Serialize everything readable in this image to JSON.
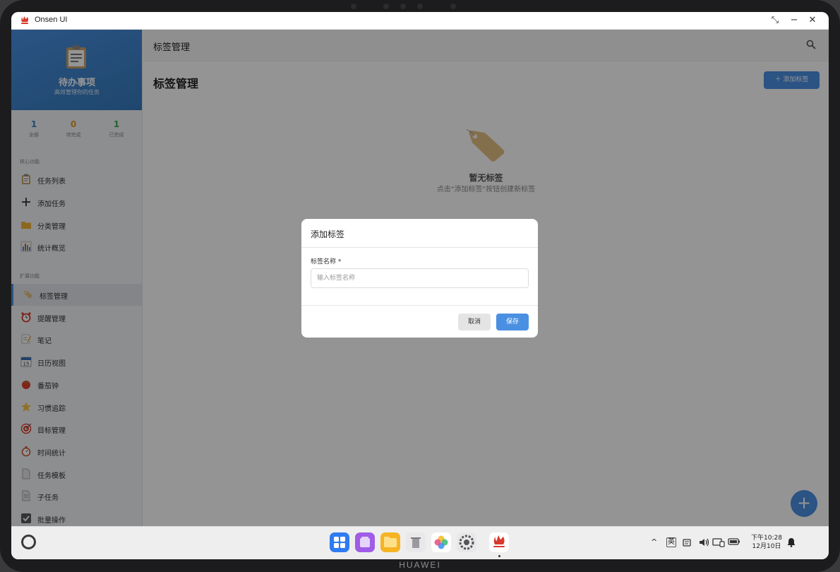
{
  "window": {
    "title": "Onsen UI",
    "brand": "HUAWEI"
  },
  "sidebar": {
    "app_name": "待办事项",
    "app_subtitle": "高效管理你的任务",
    "stats": [
      {
        "value": "1",
        "label": "全部",
        "color": "#3b82c4"
      },
      {
        "value": "0",
        "label": "待完成",
        "color": "#e09a2b"
      },
      {
        "value": "1",
        "label": "已完成",
        "color": "#3aa856"
      }
    ],
    "section_core": "核心功能",
    "section_ext": "扩展功能",
    "core_items": [
      {
        "label": "任务列表",
        "icon": "clipboard-icon"
      },
      {
        "label": "添加任务",
        "icon": "plus-icon"
      },
      {
        "label": "分类管理",
        "icon": "folder-icon"
      },
      {
        "label": "统计概览",
        "icon": "bar-chart-icon"
      }
    ],
    "ext_items": [
      {
        "label": "标签管理",
        "icon": "tag-icon",
        "active": true
      },
      {
        "label": "提醒管理",
        "icon": "alarm-clock-icon"
      },
      {
        "label": "笔记",
        "icon": "memo-icon"
      },
      {
        "label": "日历视图",
        "icon": "calendar-icon"
      },
      {
        "label": "番茄钟",
        "icon": "tomato-icon"
      },
      {
        "label": "习惯追踪",
        "icon": "star-icon"
      },
      {
        "label": "目标管理",
        "icon": "target-icon"
      },
      {
        "label": "时间统计",
        "icon": "stopwatch-icon"
      },
      {
        "label": "任务模板",
        "icon": "document-icon"
      },
      {
        "label": "子任务",
        "icon": "subtask-icon"
      },
      {
        "label": "批量操作",
        "icon": "checkbox-icon"
      }
    ]
  },
  "main": {
    "topbar_title": "标签管理",
    "page_title": "标签管理",
    "add_tag_button": "＋ 添加标签",
    "empty_title": "暂无标签",
    "empty_subtitle": "点击\"添加标签\"按钮创建新标签",
    "fab": "+"
  },
  "dialog": {
    "title": "添加标签",
    "field_label": "标签名称 *",
    "field_placeholder": "输入标签名称",
    "field_value": "",
    "cancel": "取消",
    "save": "保存"
  },
  "taskbar": {
    "ime": "英",
    "time": "下午10:28",
    "date": "12月10日",
    "apps": [
      "app-grid",
      "multitask",
      "files",
      "recycle-bin",
      "gallery",
      "settings",
      "onsen-ui"
    ]
  },
  "colors": {
    "accent": "#4a90e2",
    "sidebar_bg": "#f3f4f6"
  }
}
